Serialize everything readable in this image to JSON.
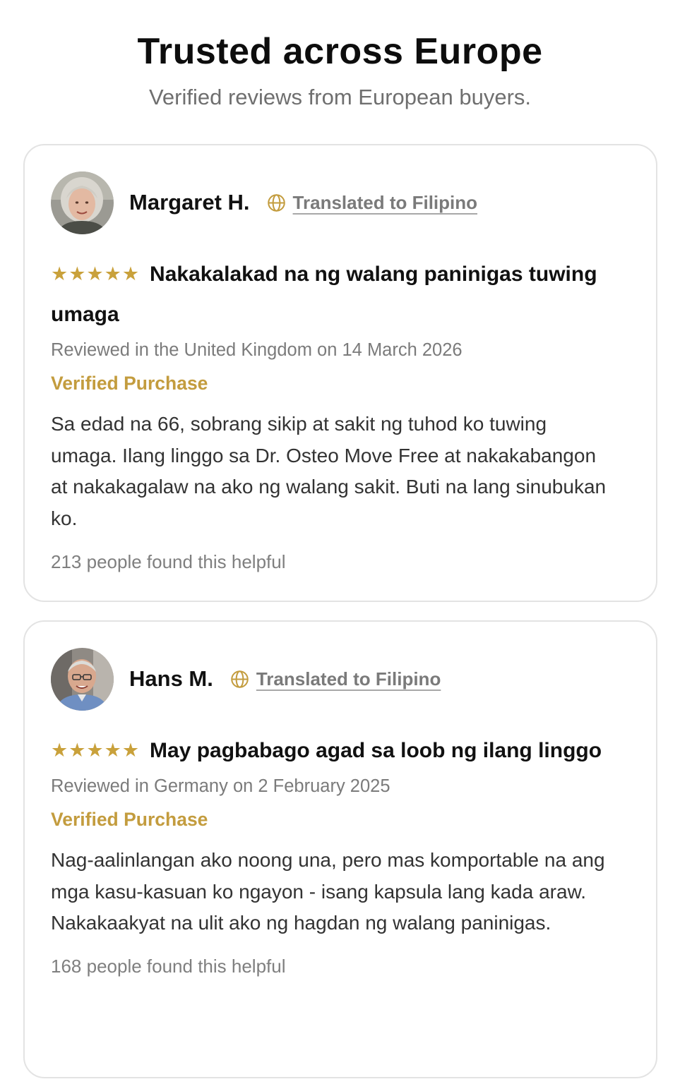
{
  "header": {
    "title": "Trusted across Europe",
    "subtitle": "Verified reviews from European buyers."
  },
  "reviews": [
    {
      "name": "Margaret H.",
      "translated_label": "Translated to Filipino",
      "stars": "★★★★★",
      "rating": 5,
      "title": "Nakakalakad na ng walang paninigas tuwing umaga",
      "meta": "Reviewed in the United Kingdom on 14 March 2026",
      "verified": "Verified Purchase",
      "body": "Sa edad na 66, sobrang sikip at sakit ng tuhod ko tuwing umaga. Ilang linggo sa Dr. Osteo Move Free at nakakabangon at nakakagalaw na ako ng walang sakit. Buti na lang sinubukan ko.",
      "helpful": "213 people found this helpful"
    },
    {
      "name": "Hans M.",
      "translated_label": "Translated to Filipino",
      "stars": "★★★★★",
      "rating": 5,
      "title": "May pagbabago agad sa loob ng ilang linggo",
      "meta": "Reviewed in Germany on 2 February 2025",
      "verified": "Verified Purchase",
      "body": "Nag-aalinlangan ako noong una, pero mas komportable na ang mga kasu-kasuan ko ngayon - isang kapsula lang kada araw. Nakakaakyat na ulit ako ng hagdan ng walang paninigas.",
      "helpful": "168 people found this helpful"
    }
  ],
  "colors": {
    "accent_gold": "#c39c3e",
    "star_gold": "#c9a13b",
    "muted_text": "#7b7b7b",
    "card_border": "#e3e3e3"
  },
  "icons": {
    "translate": "globe-icon",
    "rating": "star-icon"
  }
}
